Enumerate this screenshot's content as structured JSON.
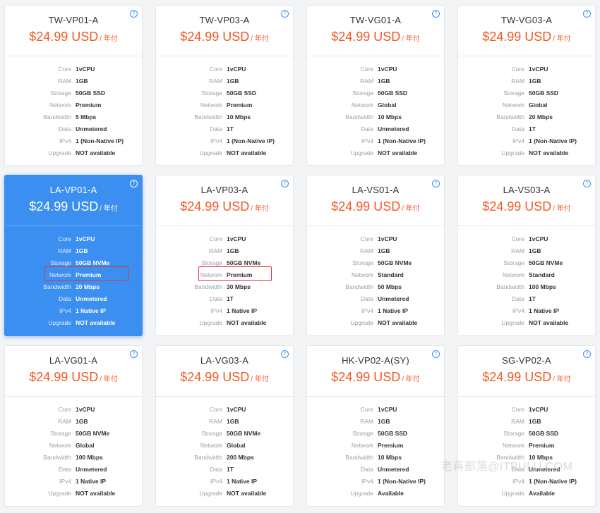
{
  "per_label": "/ 年付",
  "help_glyph": "?",
  "spec_labels": {
    "core": "Core",
    "ram": "RAM",
    "storage": "Storage",
    "network": "Network",
    "bandwidth": "Bandwidth",
    "data": "Data",
    "ipv4": "IPv4",
    "upgrade": "Upgrade"
  },
  "colors": {
    "accent": "#3b8ff0",
    "price": "#f25a24",
    "highlight": "#e0353a"
  },
  "watermark": "老蒋部落@ITBULU.COM",
  "plans": [
    {
      "name": "TW-VP01-A",
      "price": "$24.99 USD",
      "core": "1vCPU",
      "ram": "1GB",
      "storage": "50GB SSD",
      "network": "Premium",
      "bandwidth": "5 Mbps",
      "data": "Unmetered",
      "ipv4": "1 (Non-Native IP)",
      "upgrade": "NOT available"
    },
    {
      "name": "TW-VP03-A",
      "price": "$24.99 USD",
      "core": "1vCPU",
      "ram": "1GB",
      "storage": "50GB SSD",
      "network": "Premium",
      "bandwidth": "10 Mbps",
      "data": "1T",
      "ipv4": "1 (Non-Native IP)",
      "upgrade": "NOT available"
    },
    {
      "name": "TW-VG01-A",
      "price": "$24.99 USD",
      "core": "1vCPU",
      "ram": "1GB",
      "storage": "50GB SSD",
      "network": "Global",
      "bandwidth": "10 Mbps",
      "data": "Unmetered",
      "ipv4": "1 (Non-Native IP)",
      "upgrade": "NOT available"
    },
    {
      "name": "TW-VG03-A",
      "price": "$24.99 USD",
      "core": "1vCPU",
      "ram": "1GB",
      "storage": "50GB SSD",
      "network": "Global",
      "bandwidth": "20 Mbps",
      "data": "1T",
      "ipv4": "1 (Non-Native IP)",
      "upgrade": "NOT available"
    },
    {
      "name": "LA-VP01-A",
      "price": "$24.99 USD",
      "core": "1vCPU",
      "ram": "1GB",
      "storage": "50GB NVMe",
      "network": "Premium",
      "bandwidth": "20 Mbps",
      "data": "Unmetered",
      "ipv4": "1 Native IP",
      "upgrade": "NOT available",
      "selected": true
    },
    {
      "name": "LA-VP03-A",
      "price": "$24.99 USD",
      "core": "1vCPU",
      "ram": "1GB",
      "storage": "50GB NVMe",
      "network": "Premium",
      "bandwidth": "30 Mbps",
      "data": "1T",
      "ipv4": "1 Native IP",
      "upgrade": "NOT available"
    },
    {
      "name": "LA-VS01-A",
      "price": "$24.99 USD",
      "core": "1vCPU",
      "ram": "1GB",
      "storage": "50GB NVMe",
      "network": "Standard",
      "bandwidth": "50 Mbps",
      "data": "Unmetered",
      "ipv4": "1 Native IP",
      "upgrade": "NOT available"
    },
    {
      "name": "LA-VS03-A",
      "price": "$24.99 USD",
      "core": "1vCPU",
      "ram": "1GB",
      "storage": "50GB NVMe",
      "network": "Standard",
      "bandwidth": "100 Mbps",
      "data": "1T",
      "ipv4": "1 Native IP",
      "upgrade": "NOT available"
    },
    {
      "name": "LA-VG01-A",
      "price": "$24.99 USD",
      "core": "1vCPU",
      "ram": "1GB",
      "storage": "50GB NVMe",
      "network": "Global",
      "bandwidth": "100 Mbps",
      "data": "Unmetered",
      "ipv4": "1 Native IP",
      "upgrade": "NOT available"
    },
    {
      "name": "LA-VG03-A",
      "price": "$24.99 USD",
      "core": "1vCPU",
      "ram": "1GB",
      "storage": "50GB NVMe",
      "network": "Global",
      "bandwidth": "200 Mbps",
      "data": "1T",
      "ipv4": "1 Native IP",
      "upgrade": "NOT available"
    },
    {
      "name": "HK-VP02-A(SY)",
      "price": "$24.99 USD",
      "core": "1vCPU",
      "ram": "1GB",
      "storage": "50GB SSD",
      "network": "Premium",
      "bandwidth": "10 Mbps",
      "data": "Unmetered",
      "ipv4": "1 (Non-Native IP)",
      "upgrade": "Available"
    },
    {
      "name": "SG-VP02-A",
      "price": "$24.99 USD",
      "core": "1vCPU",
      "ram": "1GB",
      "storage": "50GB SSD",
      "network": "Premium",
      "bandwidth": "10 Mbps",
      "data": "Unmetered",
      "ipv4": "1 (Non-Native IP)",
      "upgrade": "Available"
    }
  ]
}
